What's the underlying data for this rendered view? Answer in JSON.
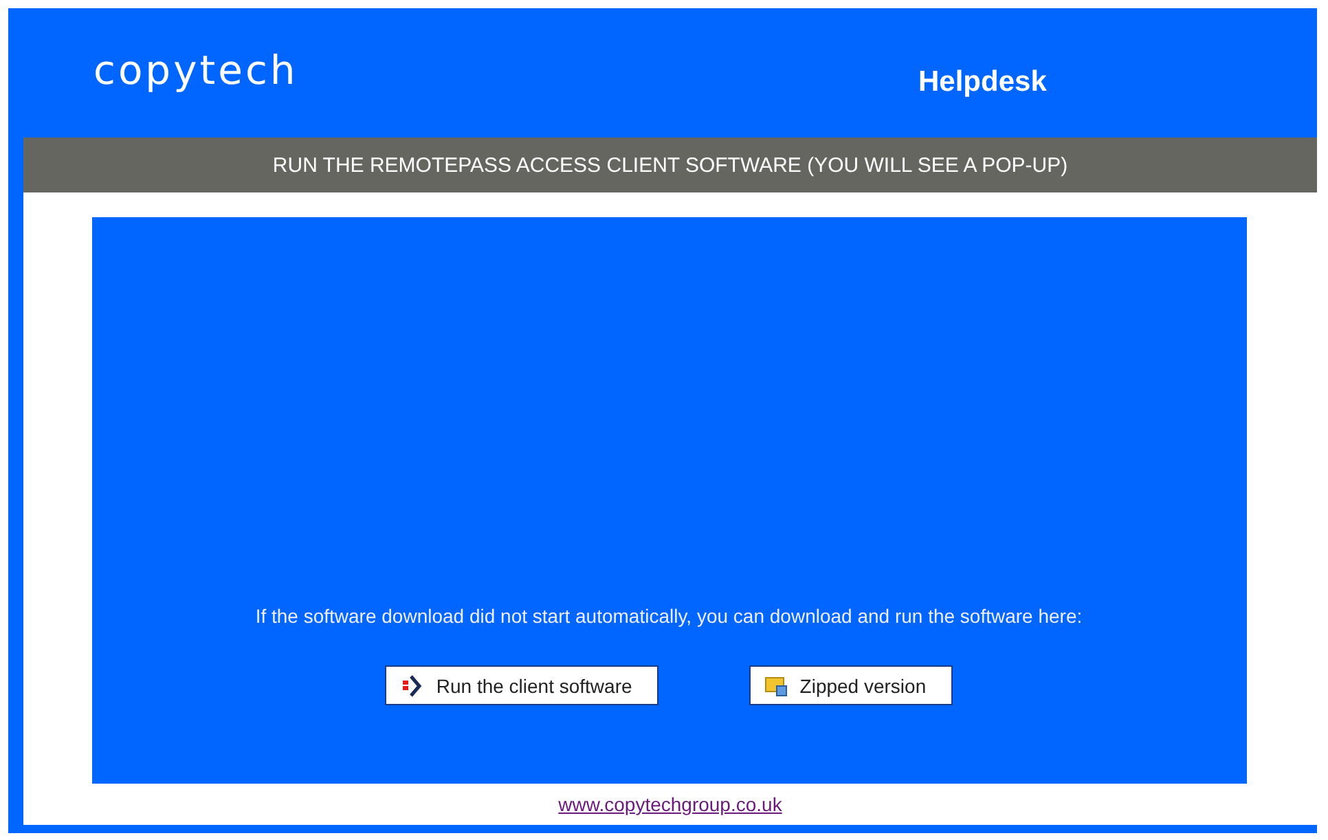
{
  "header": {
    "logo": "copytech",
    "title": "Helpdesk"
  },
  "banner": "RUN THE REMOTEPASS ACCESS CLIENT SOFTWARE (YOU WILL SEE A POP-UP)",
  "panel": {
    "message": "If the software download did not start automatically, you can download and run the software here:",
    "buttons": [
      {
        "label": "Run the client software",
        "kind": "run"
      },
      {
        "label": "Zipped version",
        "kind": "zip"
      }
    ]
  },
  "footer": {
    "link": "www.copytechgroup.co.uk"
  }
}
